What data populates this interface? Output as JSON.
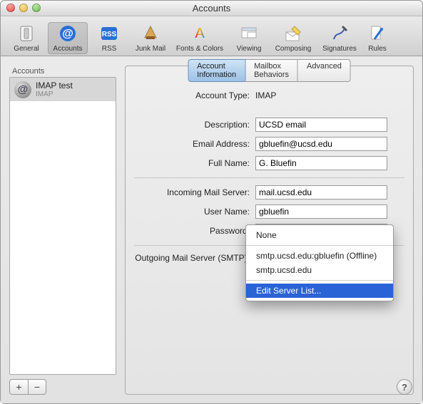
{
  "window": {
    "title": "Accounts"
  },
  "toolbar": {
    "items": [
      {
        "label": "General"
      },
      {
        "label": "Accounts"
      },
      {
        "label": "RSS"
      },
      {
        "label": "Junk Mail"
      },
      {
        "label": "Fonts & Colors"
      },
      {
        "label": "Viewing"
      },
      {
        "label": "Composing"
      },
      {
        "label": "Signatures"
      },
      {
        "label": "Rules"
      }
    ]
  },
  "sidebar": {
    "header": "Accounts",
    "account": {
      "name": "IMAP test",
      "type": "IMAP"
    },
    "plus": "+",
    "minus": "−"
  },
  "tabs": {
    "info": "Account Information",
    "mailbox": "Mailbox Behaviors",
    "advanced": "Advanced"
  },
  "labels": {
    "account_type": "Account Type:",
    "description": "Description:",
    "email": "Email Address:",
    "full_name": "Full Name:",
    "incoming": "Incoming Mail Server:",
    "user": "User Name:",
    "password": "Password:",
    "smtp": "Outgoing Mail Server (SMTP):"
  },
  "values": {
    "account_type": "IMAP",
    "description": "UCSD email",
    "email": "gbluefin@ucsd.edu",
    "full_name": "G. Bluefin",
    "incoming": "mail.ucsd.edu",
    "user": "gbluefin",
    "password": ""
  },
  "smtp_menu": {
    "none": "None",
    "opt1": "smtp.ucsd.edu:gbluefin (Offline)",
    "opt2": "smtp.ucsd.edu",
    "edit": "Edit Server List..."
  },
  "help": "?"
}
